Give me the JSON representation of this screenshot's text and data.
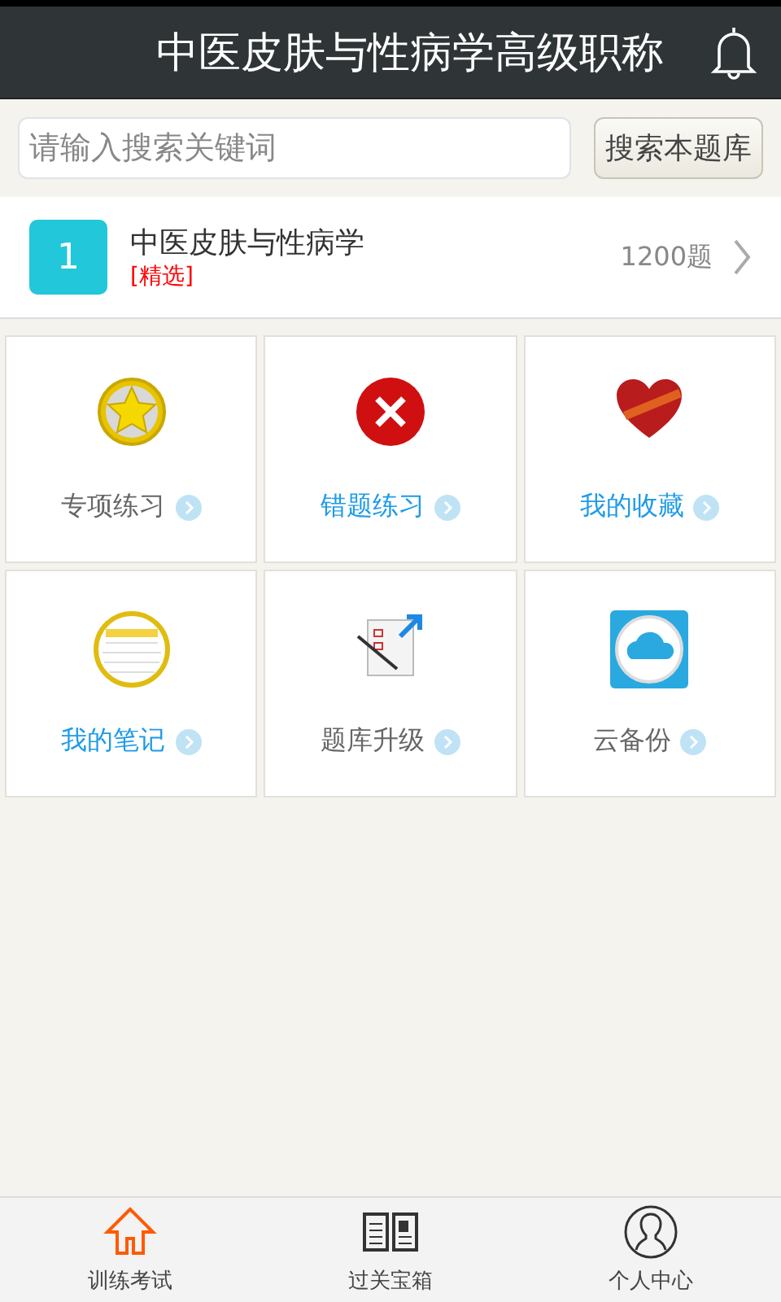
{
  "header": {
    "title": "中医皮肤与性病学高级职称"
  },
  "search": {
    "placeholder": "请输入搜索关键词",
    "button": "搜索本题库"
  },
  "bank": {
    "number": "1",
    "name": "中医皮肤与性病学",
    "tag": "[精选]",
    "count": "1200题"
  },
  "tiles": [
    {
      "kind": "star",
      "label": "专项练习",
      "color": "#666666"
    },
    {
      "kind": "wrong",
      "label": "错题练习",
      "color": "#1e9be8"
    },
    {
      "kind": "heart",
      "label": "我的收藏",
      "color": "#1e9be8"
    },
    {
      "kind": "notes",
      "label": "我的笔记",
      "color": "#1e9be8"
    },
    {
      "kind": "upgrade",
      "label": "题库升级",
      "color": "#666666"
    },
    {
      "kind": "cloud",
      "label": "云备份",
      "color": "#666666"
    }
  ],
  "tabs": [
    {
      "kind": "home",
      "label": "训练考试",
      "selected": true
    },
    {
      "kind": "book",
      "label": "过关宝箱",
      "selected": false
    },
    {
      "kind": "person",
      "label": "个人中心",
      "selected": false
    }
  ]
}
